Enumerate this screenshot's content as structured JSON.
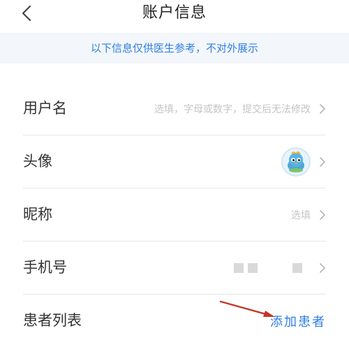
{
  "header": {
    "title": "账户信息",
    "back_icon": "chevron-left-icon"
  },
  "notice": {
    "text": "以下信息仅供医生参考，不对外展示"
  },
  "rows": [
    {
      "label": "用户名",
      "value": "选填，字母或数字，提交后无法修改"
    },
    {
      "label": "头像",
      "value": ""
    },
    {
      "label": "昵称",
      "value": "选填"
    },
    {
      "label": "手机号",
      "value": ""
    },
    {
      "label": "患者列表",
      "value": "添加患者"
    }
  ],
  "colors": {
    "accent": "#2f7fe0",
    "annotation_arrow": "#c0392b",
    "notice_bg": "#f3f7fb"
  }
}
